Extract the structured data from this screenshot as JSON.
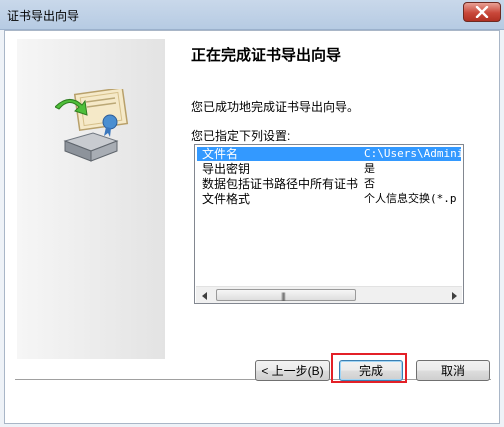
{
  "window": {
    "title": "证书导出向导"
  },
  "heading": "正在完成证书导出向导",
  "description": "您已成功地完成证书导出向导。",
  "settings_label": "您已指定下列设置:",
  "settings": [
    {
      "key": "文件名",
      "value": "C:\\Users\\Adminis",
      "selected": true
    },
    {
      "key": "导出密钥",
      "value": "是"
    },
    {
      "key": "数据包括证书路径中所有证书",
      "value": "否"
    },
    {
      "key": "文件格式",
      "value": "个人信息交换(*.p"
    }
  ],
  "scrollbar": {
    "grip": "|||"
  },
  "buttons": {
    "back": "< 上一步(B)",
    "finish": "完成",
    "cancel": "取消"
  },
  "colors": {
    "selection": "#3399ff",
    "highlight_box": "#e32027"
  }
}
